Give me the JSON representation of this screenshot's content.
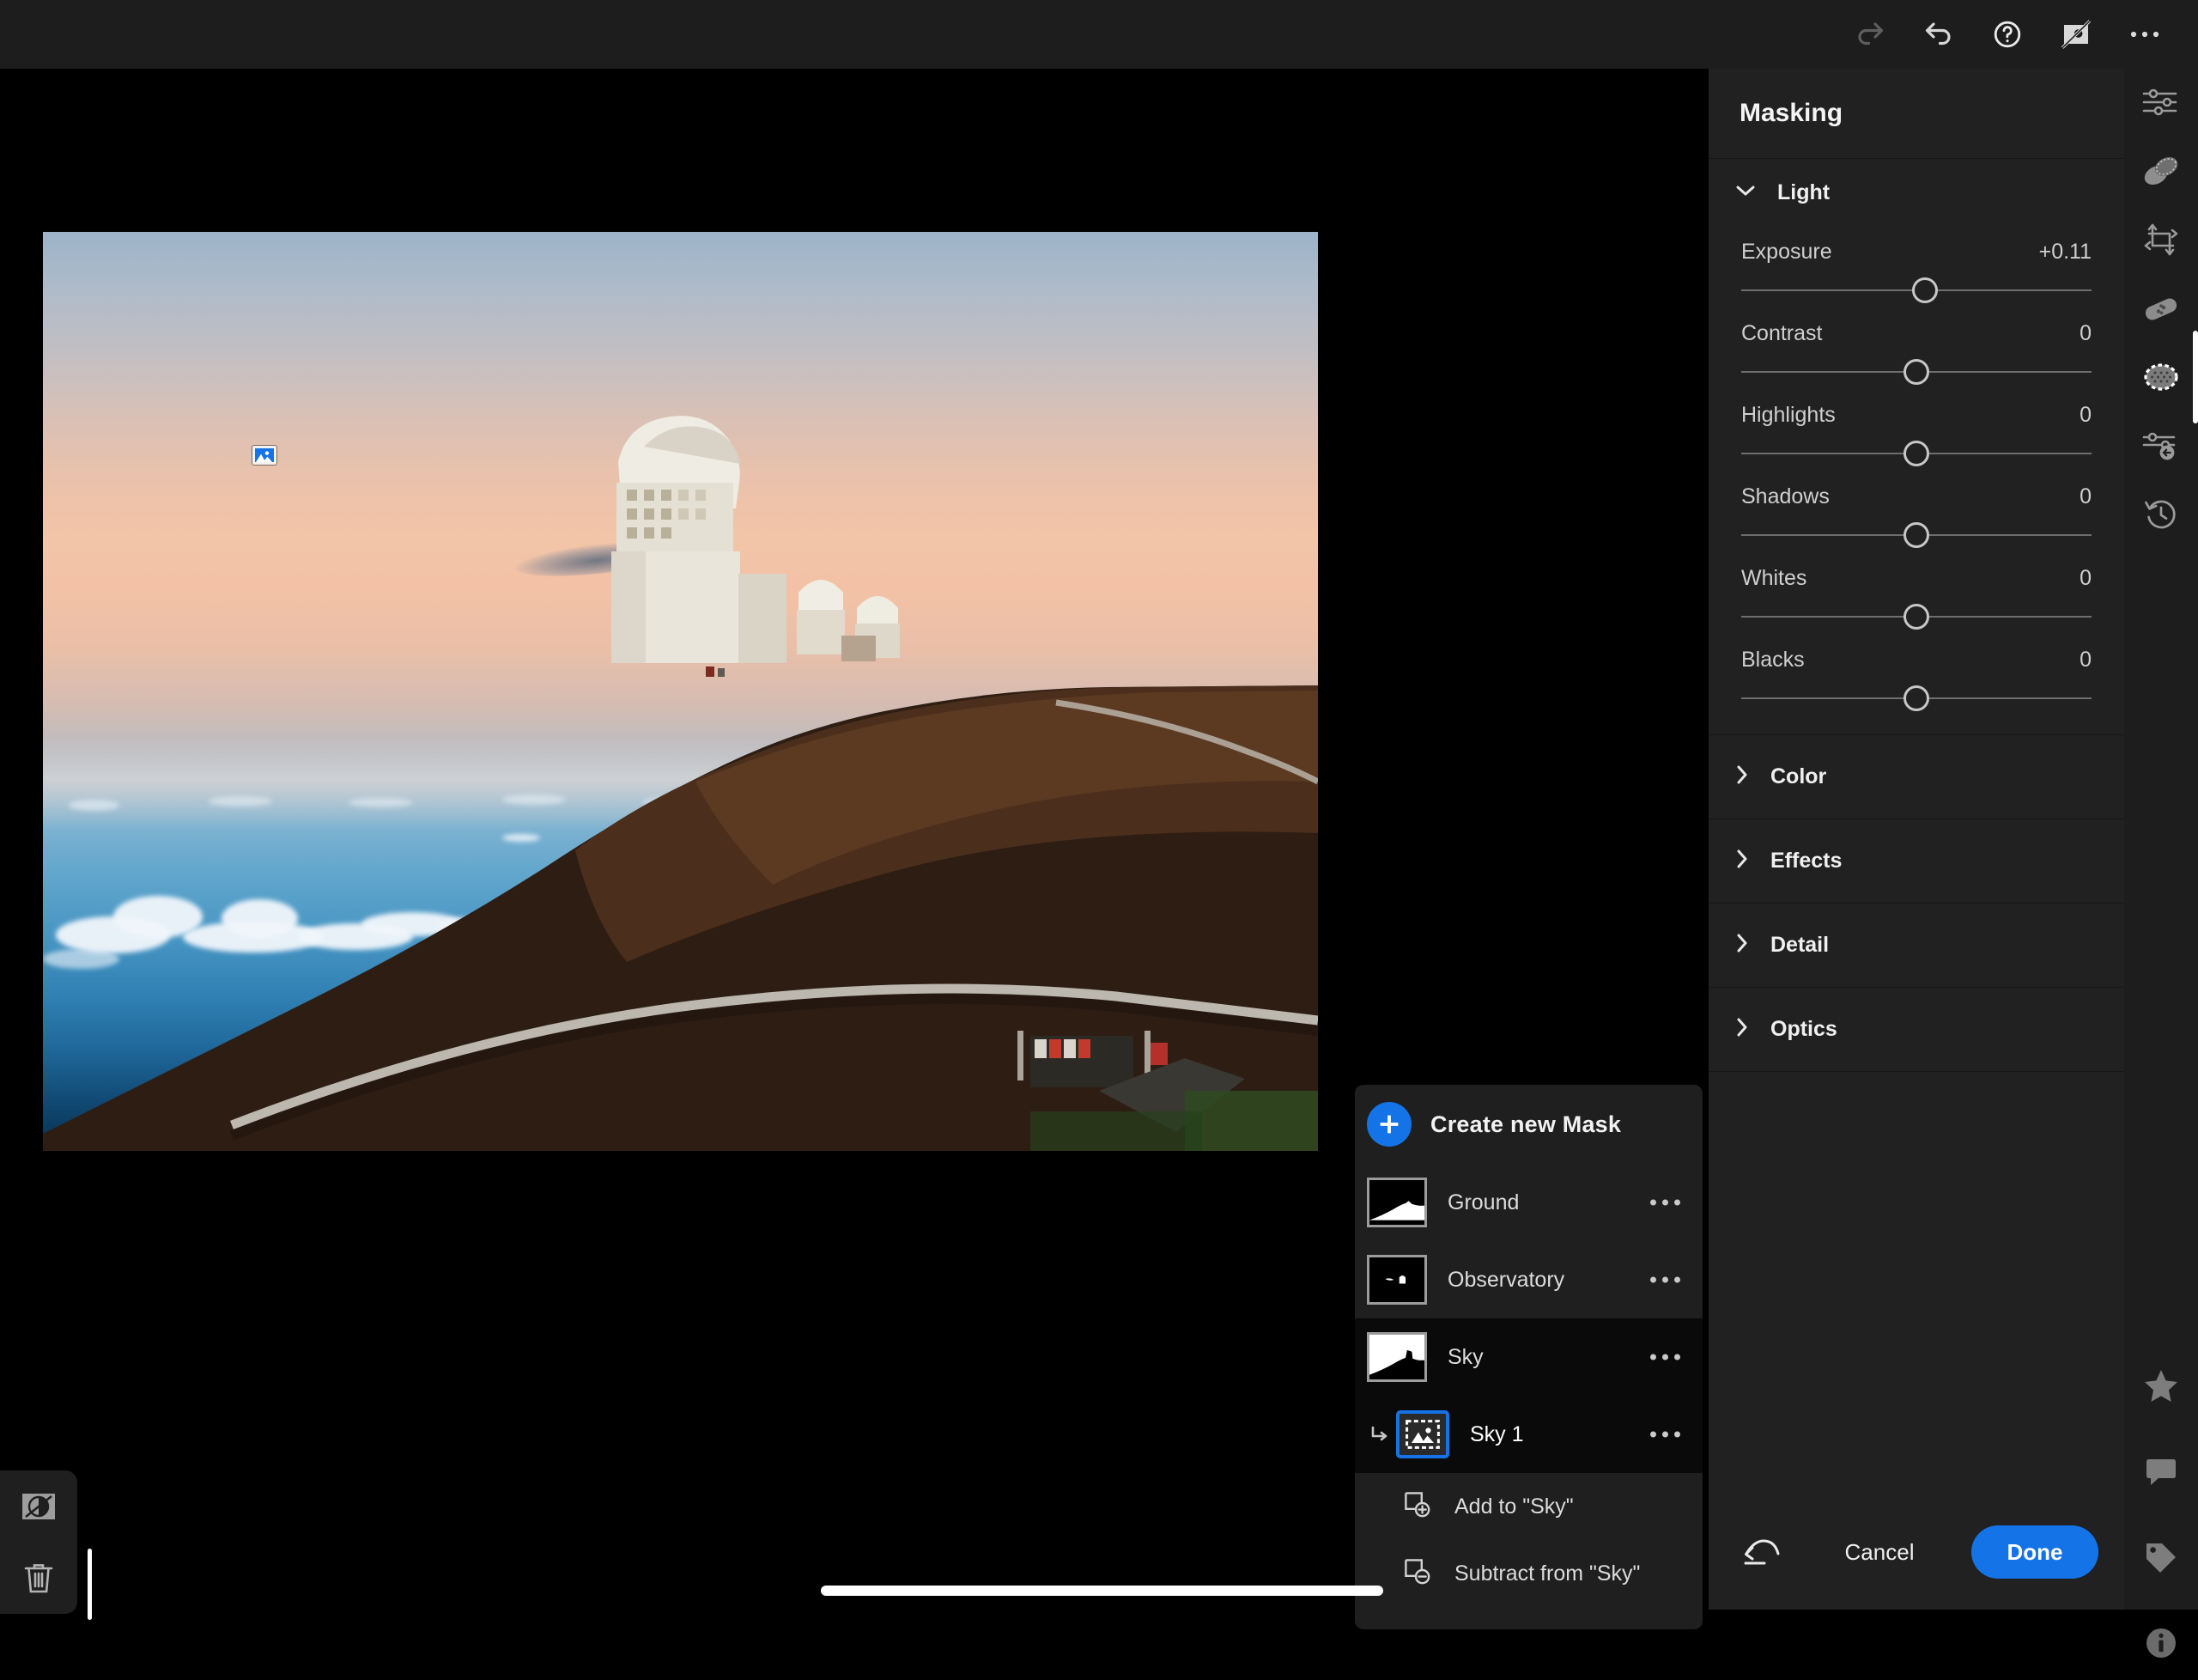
{
  "topbar": {
    "buttons": [
      {
        "name": "redo-icon",
        "label": "Redo",
        "disabled": true
      },
      {
        "name": "undo-icon",
        "label": "Undo",
        "disabled": false
      },
      {
        "name": "help-icon",
        "label": "Help",
        "disabled": false
      },
      {
        "name": "hide-mask-overlay-icon",
        "label": "Hide Mask Overlay",
        "disabled": false
      },
      {
        "name": "more-options-icon",
        "label": "More Options",
        "disabled": false
      }
    ]
  },
  "panel": {
    "title": "Masking",
    "light_section": {
      "label": "Light",
      "expanded": true,
      "sliders": [
        {
          "label": "Exposure",
          "value": "+0.11",
          "pos": 52.5
        },
        {
          "label": "Contrast",
          "value": "0",
          "pos": 50
        },
        {
          "label": "Highlights",
          "value": "0",
          "pos": 50
        },
        {
          "label": "Shadows",
          "value": "0",
          "pos": 50
        },
        {
          "label": "Whites",
          "value": "0",
          "pos": 50
        },
        {
          "label": "Blacks",
          "value": "0",
          "pos": 50
        }
      ]
    },
    "collapsed_sections": [
      {
        "label": "Color"
      },
      {
        "label": "Effects"
      },
      {
        "label": "Detail"
      },
      {
        "label": "Optics"
      }
    ],
    "footer": {
      "reset_label": "Reset",
      "cancel_label": "Cancel",
      "done_label": "Done"
    }
  },
  "mask_panel": {
    "create_label": "Create new Mask",
    "masks": [
      {
        "name": "Ground",
        "thumb": "ground",
        "selected": false,
        "menu": "more-options"
      },
      {
        "name": "Observatory",
        "thumb": "observatory",
        "selected": false,
        "menu": "more-options"
      },
      {
        "name": "Sky",
        "thumb": "sky",
        "selected": true,
        "menu": "more-options"
      }
    ],
    "submask": {
      "name": "Sky 1",
      "icon": "select-subject-icon",
      "selected": true,
      "menu": "more-options"
    },
    "actions": [
      {
        "label": "Add to \"Sky\"",
        "icon": "add-to-mask-icon"
      },
      {
        "label": "Subtract from \"Sky\"",
        "icon": "subtract-from-mask-icon"
      }
    ]
  },
  "left_tools": [
    {
      "name": "invert-mask-icon",
      "label": "Invert Mask"
    },
    {
      "name": "delete-mask-icon",
      "label": "Delete Mask"
    }
  ],
  "rail": {
    "top_items": [
      {
        "name": "edit-icon",
        "label": "Edit",
        "selected": false
      },
      {
        "name": "presets-icon",
        "label": "Presets",
        "selected": false
      },
      {
        "name": "crop-icon",
        "label": "Crop",
        "selected": false
      },
      {
        "name": "healing-icon",
        "label": "Healing",
        "selected": false
      },
      {
        "name": "masking-icon",
        "label": "Masking",
        "selected": true
      },
      {
        "name": "prev-edits-icon",
        "label": "Previous Edits",
        "selected": false
      },
      {
        "name": "versions-icon",
        "label": "Versions",
        "selected": false
      }
    ],
    "bottom_items": [
      {
        "name": "star-rating-icon",
        "label": "Rating"
      },
      {
        "name": "comments-icon",
        "label": "Comments"
      },
      {
        "name": "keywords-icon",
        "label": "Keywords"
      },
      {
        "name": "info-icon",
        "label": "Info"
      }
    ]
  },
  "canvas": {
    "mask_pin": {
      "name": "image-mask-pin",
      "label": "Sky 1 mask pin"
    },
    "photo_alt": "Observatory on volcanic ridge at sunset above ocean clouds"
  },
  "colors": {
    "accent": "#1473e6",
    "panel_bg": "#212121",
    "rail_bg": "#1d1d1d",
    "canvas_bg": "#000000",
    "mask_panel_bg": "#1f1f1f",
    "text": "#d6d6d6"
  }
}
